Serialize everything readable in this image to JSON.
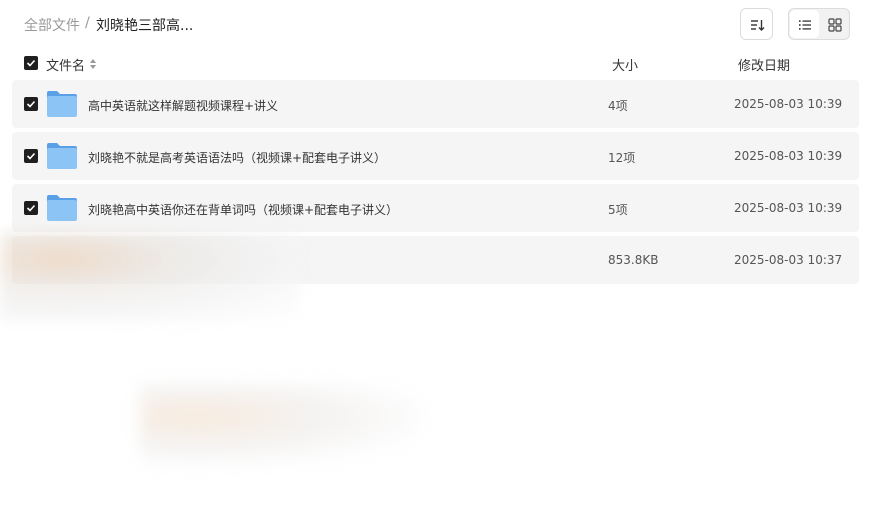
{
  "breadcrumb": {
    "root": "全部文件",
    "separator": "/",
    "current": "刘晓艳三部高..."
  },
  "toolbar": {
    "sort_icon": "sort-descending-icon",
    "list_view_icon": "list-view-icon",
    "grid_view_icon": "grid-view-icon",
    "active_view": "list"
  },
  "table": {
    "columns": {
      "name": "文件名",
      "size": "大小",
      "date": "修改日期"
    },
    "select_all_checked": true,
    "rows": [
      {
        "name": "高中英语就这样解题视频课程+讲义",
        "size": "4项",
        "date": "2025-08-03 10:39",
        "type": "folder",
        "checked": true
      },
      {
        "name": "刘晓艳不就是高考英语语法吗（视频课+配套电子讲义）",
        "size": "12项",
        "date": "2025-08-03 10:39",
        "type": "folder",
        "checked": true
      },
      {
        "name": "刘晓艳高中英语你还在背单词吗（视频课+配套电子讲义）",
        "size": "5项",
        "date": "2025-08-03 10:39",
        "type": "folder",
        "checked": true
      },
      {
        "name": "",
        "size": "853.8KB",
        "date": "2025-08-03 10:37",
        "type": "file",
        "checked": false
      }
    ]
  },
  "colors": {
    "folder_blue": "#7fb8f0",
    "checkbox_dark": "#1f1f1f",
    "row_bg": "#f5f5f5"
  }
}
